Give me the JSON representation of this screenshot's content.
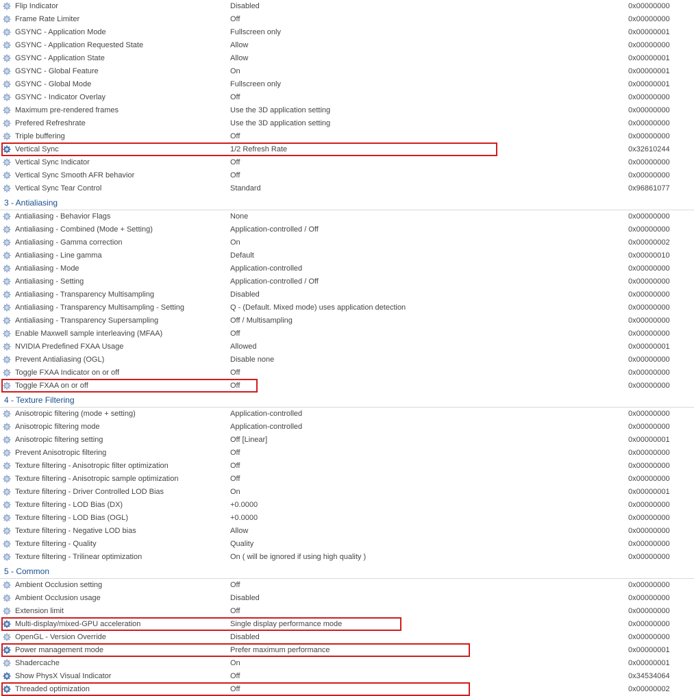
{
  "sections": [
    {
      "header": null,
      "rows": [
        {
          "name": "Flip Indicator",
          "value": "Disabled",
          "hex": "0x00000000"
        },
        {
          "name": "Frame Rate Limiter",
          "value": "Off",
          "hex": "0x00000000"
        },
        {
          "name": "GSYNC - Application Mode",
          "value": "Fullscreen only",
          "hex": "0x00000001"
        },
        {
          "name": "GSYNC - Application Requested State",
          "value": "Allow",
          "hex": "0x00000000"
        },
        {
          "name": "GSYNC - Application State",
          "value": "Allow",
          "hex": "0x00000001"
        },
        {
          "name": "GSYNC - Global Feature",
          "value": "On",
          "hex": "0x00000001"
        },
        {
          "name": "GSYNC - Global Mode",
          "value": "Fullscreen only",
          "hex": "0x00000001"
        },
        {
          "name": "GSYNC - Indicator Overlay",
          "value": "Off",
          "hex": "0x00000000"
        },
        {
          "name": "Maximum pre-rendered frames",
          "value": "Use the 3D application setting",
          "hex": "0x00000000"
        },
        {
          "name": "Prefered Refreshrate",
          "value": "Use the 3D application setting",
          "hex": "0x00000000"
        },
        {
          "name": "Triple buffering",
          "value": "Off",
          "hex": "0x00000000"
        },
        {
          "name": "Vertical Sync",
          "value": "1/2 Refresh Rate",
          "hex": "0x32610244",
          "hl": 720,
          "bold": true
        },
        {
          "name": "Vertical Sync Indicator",
          "value": "Off",
          "hex": "0x00000000"
        },
        {
          "name": "Vertical Sync Smooth AFR behavior",
          "value": "Off",
          "hex": "0x00000000"
        },
        {
          "name": "Vertical Sync Tear Control",
          "value": "Standard",
          "hex": "0x96861077"
        }
      ]
    },
    {
      "header": "3 - Antialiasing",
      "rows": [
        {
          "name": "Antialiasing - Behavior Flags",
          "value": "None",
          "hex": "0x00000000"
        },
        {
          "name": "Antialiasing - Combined (Mode + Setting)",
          "value": "Application-controlled / Off",
          "hex": "0x00000000"
        },
        {
          "name": "Antialiasing - Gamma correction",
          "value": "On",
          "hex": "0x00000002"
        },
        {
          "name": "Antialiasing - Line gamma",
          "value": "Default",
          "hex": "0x00000010"
        },
        {
          "name": "Antialiasing - Mode",
          "value": "Application-controlled",
          "hex": "0x00000000"
        },
        {
          "name": "Antialiasing - Setting",
          "value": "Application-controlled / Off",
          "hex": "0x00000000"
        },
        {
          "name": "Antialiasing - Transparency Multisampling",
          "value": "Disabled",
          "hex": "0x00000000"
        },
        {
          "name": "Antialiasing - Transparency Multisampling - Setting",
          "value": "Q - (Default. Mixed mode) uses application detection",
          "hex": "0x00000000"
        },
        {
          "name": "Antialiasing - Transparency Supersampling",
          "value": "Off / Multisampling",
          "hex": "0x00000000"
        },
        {
          "name": "Enable Maxwell sample interleaving (MFAA)",
          "value": "Off",
          "hex": "0x00000000"
        },
        {
          "name": "NVIDIA Predefined FXAA Usage",
          "value": "Allowed",
          "hex": "0x00000001"
        },
        {
          "name": "Prevent Antialiasing (OGL)",
          "value": "Disable none",
          "hex": "0x00000000"
        },
        {
          "name": "Toggle FXAA Indicator on or off",
          "value": "Off",
          "hex": "0x00000000"
        },
        {
          "name": "Toggle FXAA on or off",
          "value": "Off",
          "hex": "0x00000000",
          "hl": 370
        }
      ]
    },
    {
      "header": "4 - Texture Filtering",
      "rows": [
        {
          "name": "Anisotropic filtering (mode + setting)",
          "value": "Application-controlled",
          "hex": "0x00000000"
        },
        {
          "name": "Anisotropic filtering mode",
          "value": "Application-controlled",
          "hex": "0x00000000"
        },
        {
          "name": "Anisotropic filtering setting",
          "value": "Off [Linear]",
          "hex": "0x00000001"
        },
        {
          "name": "Prevent Anisotropic filtering",
          "value": "Off",
          "hex": "0x00000000"
        },
        {
          "name": "Texture filtering - Anisotropic filter optimization",
          "value": "Off",
          "hex": "0x00000000"
        },
        {
          "name": "Texture filtering - Anisotropic sample optimization",
          "value": "Off",
          "hex": "0x00000000"
        },
        {
          "name": "Texture filtering - Driver Controlled LOD Bias",
          "value": "On",
          "hex": "0x00000001"
        },
        {
          "name": "Texture filtering - LOD Bias (DX)",
          "value": "+0.0000",
          "hex": "0x00000000"
        },
        {
          "name": "Texture filtering - LOD Bias (OGL)",
          "value": "+0.0000",
          "hex": "0x00000000"
        },
        {
          "name": "Texture filtering - Negative LOD bias",
          "value": "Allow",
          "hex": "0x00000000"
        },
        {
          "name": "Texture filtering - Quality",
          "value": "Quality",
          "hex": "0x00000000"
        },
        {
          "name": "Texture filtering - Trilinear optimization",
          "value": "On ( will be ignored if using high quality )",
          "hex": "0x00000000"
        }
      ]
    },
    {
      "header": "5 - Common",
      "rows": [
        {
          "name": "Ambient Occlusion setting",
          "value": "Off",
          "hex": "0x00000000"
        },
        {
          "name": "Ambient Occlusion usage",
          "value": "Disabled",
          "hex": "0x00000000"
        },
        {
          "name": "Extension limit",
          "value": "Off",
          "hex": "0x00000000"
        },
        {
          "name": "Multi-display/mixed-GPU acceleration",
          "value": "Single display performance mode",
          "hex": "0x00000000",
          "hl": 580,
          "bold": true
        },
        {
          "name": "OpenGL - Version Override",
          "value": "Disabled",
          "hex": "0x00000000"
        },
        {
          "name": "Power management mode",
          "value": "Prefer maximum performance",
          "hex": "0x00000001",
          "hl": 680,
          "bold": true
        },
        {
          "name": "Shadercache",
          "value": "On",
          "hex": "0x00000001"
        },
        {
          "name": "Show PhysX Visual Indicator",
          "value": "Off",
          "hex": "0x34534064",
          "bold": true
        },
        {
          "name": "Threaded optimization",
          "value": "Off",
          "hex": "0x00000002",
          "hl": 680,
          "bold": true
        }
      ]
    }
  ]
}
